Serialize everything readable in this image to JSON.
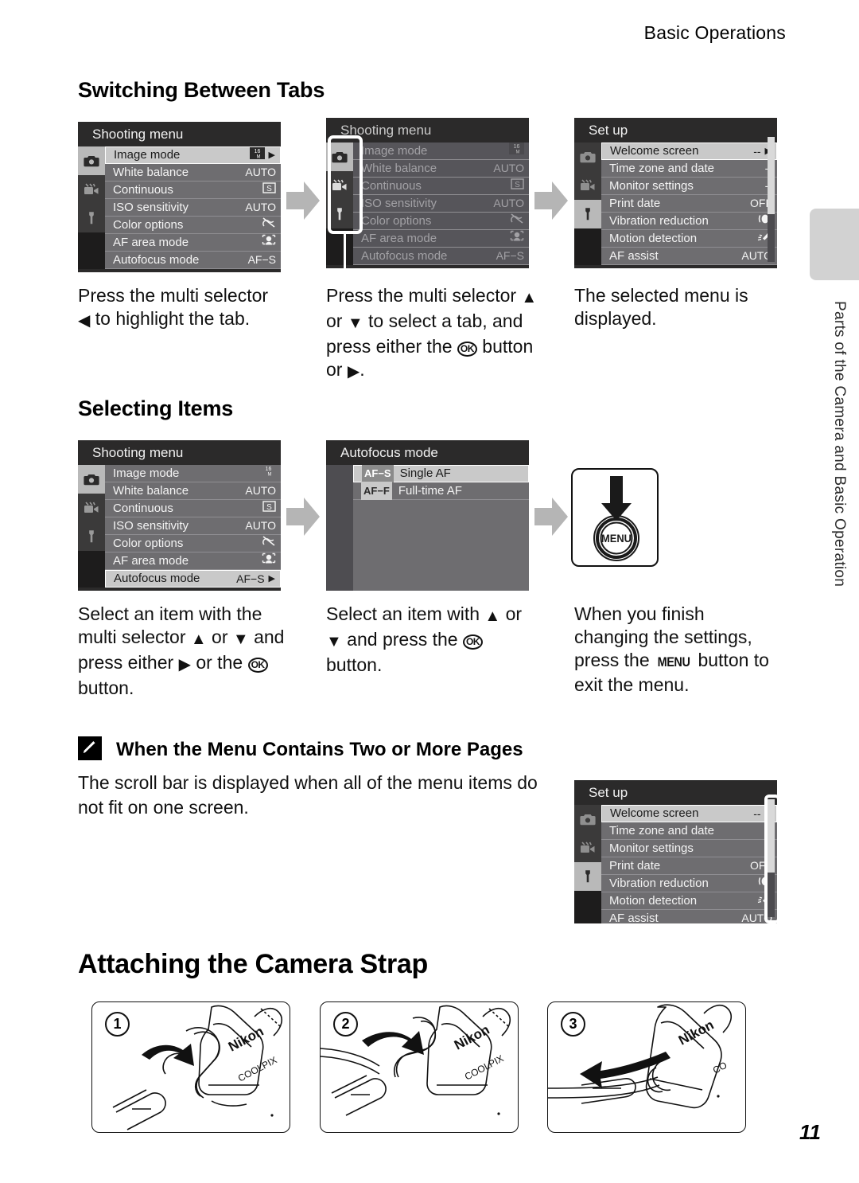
{
  "running_head": "Basic Operations",
  "page_number": "11",
  "side_tab_label": "Parts of the Camera and Basic Operation",
  "sections": {
    "switching_tabs": {
      "heading": "Switching Between Tabs",
      "captions": [
        "Press the multi selector ◀ to highlight the tab.",
        "Press the multi selector ▲ or ▼ to select a tab, and press either the OK button or ▶.",
        "The selected menu is displayed."
      ]
    },
    "selecting_items": {
      "heading": "Selecting Items",
      "captions": [
        "Select an item with the multi selector ▲ or ▼ and press either ▶ or the OK button.",
        "Select an item with ▲ or ▼ and press the OK button.",
        "When you finish changing the settings, press the MENU button to exit the menu."
      ]
    },
    "note": {
      "icon": "pencil-icon",
      "title": "When the Menu Contains Two or More Pages",
      "body": "The scroll bar is displayed when all of the menu items do not fit on one screen."
    },
    "strap": {
      "heading": "Attaching the Camera Strap",
      "figures": [
        {
          "number": "1",
          "brand": "Nikon",
          "sub_brand": "COOLPIX"
        },
        {
          "number": "2",
          "brand": "Nikon",
          "sub_brand": "COOLPIX"
        },
        {
          "number": "3",
          "brand": "Nikon",
          "sub_brand": "CO"
        }
      ]
    }
  },
  "screens": {
    "shooting_menu_1": {
      "title": "Shooting menu",
      "tabs": [
        "camera-icon",
        "movie-icon",
        "wrench-icon"
      ],
      "active_tab": 0,
      "rows": [
        {
          "label": "Image mode",
          "value": "16M",
          "selected": true,
          "caret": true
        },
        {
          "label": "White balance",
          "value": "AUTO",
          "selected": false,
          "caret": false
        },
        {
          "label": "Continuous",
          "value": "S",
          "selected": false,
          "caret": false
        },
        {
          "label": "ISO sensitivity",
          "value": "AUTO",
          "selected": false,
          "caret": false
        },
        {
          "label": "Color options",
          "value": "off-color-icon",
          "selected": false,
          "caret": false
        },
        {
          "label": "AF area mode",
          "value": "face-priority-icon",
          "selected": false,
          "caret": false
        },
        {
          "label": "Autofocus mode",
          "value": "AF−S",
          "selected": false,
          "caret": false
        }
      ]
    },
    "shooting_menu_2": {
      "title": "Shooting menu",
      "dimmed": true,
      "tabs": [
        "camera-icon",
        "movie-icon",
        "wrench-icon"
      ],
      "active_tab": 0,
      "tab_highlighted": true,
      "rows": [
        {
          "label": "Image mode",
          "value": "16M"
        },
        {
          "label": "White balance",
          "value": "AUTO"
        },
        {
          "label": "Continuous",
          "value": "S"
        },
        {
          "label": "ISO sensitivity",
          "value": "AUTO"
        },
        {
          "label": "Color options",
          "value": "off-color-icon"
        },
        {
          "label": "AF area mode",
          "value": "face-priority-icon"
        },
        {
          "label": "Autofocus mode",
          "value": "AF−S"
        }
      ]
    },
    "setup_menu": {
      "title": "Set up",
      "tabs": [
        "camera-icon",
        "movie-icon",
        "wrench-icon"
      ],
      "active_tab": 2,
      "rows": [
        {
          "label": "Welcome screen",
          "value": "--",
          "selected": true,
          "caret": true
        },
        {
          "label": "Time zone and date",
          "value": "--",
          "selected": false,
          "caret": false
        },
        {
          "label": "Monitor settings",
          "value": "--",
          "selected": false,
          "caret": false
        },
        {
          "label": "Print date",
          "value": "OFF",
          "selected": false,
          "caret": false
        },
        {
          "label": "Vibration reduction",
          "value": "vr-icon",
          "selected": false,
          "caret": false
        },
        {
          "label": "Motion detection",
          "value": "motion-icon",
          "selected": false,
          "caret": false
        },
        {
          "label": "AF assist",
          "value": "AUTO",
          "selected": false,
          "caret": false
        }
      ]
    },
    "shooting_menu_3": {
      "title": "Shooting menu",
      "tabs": [
        "camera-icon",
        "movie-icon",
        "wrench-icon"
      ],
      "active_tab": 0,
      "rows": [
        {
          "label": "Image mode",
          "value": "16M",
          "selected": false,
          "caret": false
        },
        {
          "label": "White balance",
          "value": "AUTO",
          "selected": false,
          "caret": false
        },
        {
          "label": "Continuous",
          "value": "S",
          "selected": false,
          "caret": false
        },
        {
          "label": "ISO sensitivity",
          "value": "AUTO",
          "selected": false,
          "caret": false
        },
        {
          "label": "Color options",
          "value": "off-color-icon",
          "selected": false,
          "caret": false
        },
        {
          "label": "AF area mode",
          "value": "face-priority-icon",
          "selected": false,
          "caret": false
        },
        {
          "label": "Autofocus mode",
          "value": "AF−S",
          "selected": true,
          "caret": true
        }
      ]
    },
    "autofocus_mode": {
      "title": "Autofocus mode",
      "options": [
        {
          "code": "AF−S",
          "label": "Single AF",
          "selected": true
        },
        {
          "code": "AF−F",
          "label": "Full-time AF",
          "selected": false
        }
      ]
    },
    "setup_menu_scroll": {
      "title": "Set up",
      "tabs": [
        "camera-icon",
        "movie-icon",
        "wrench-icon"
      ],
      "active_tab": 2,
      "scrollbar": true,
      "rows": [
        {
          "label": "Welcome screen",
          "value": "--",
          "selected": true,
          "caret": true
        },
        {
          "label": "Time zone and date",
          "value": "--",
          "selected": false,
          "caret": false
        },
        {
          "label": "Monitor settings",
          "value": "--",
          "selected": false,
          "caret": false
        },
        {
          "label": "Print date",
          "value": "OFF",
          "selected": false,
          "caret": false
        },
        {
          "label": "Vibration reduction",
          "value": "vr-icon",
          "selected": false,
          "caret": false
        },
        {
          "label": "Motion detection",
          "value": "motion-icon",
          "selected": false,
          "caret": false
        },
        {
          "label": "AF assist",
          "value": "AUTO",
          "selected": false,
          "caret": false
        }
      ]
    }
  },
  "menu_button": {
    "label": "MENU"
  }
}
